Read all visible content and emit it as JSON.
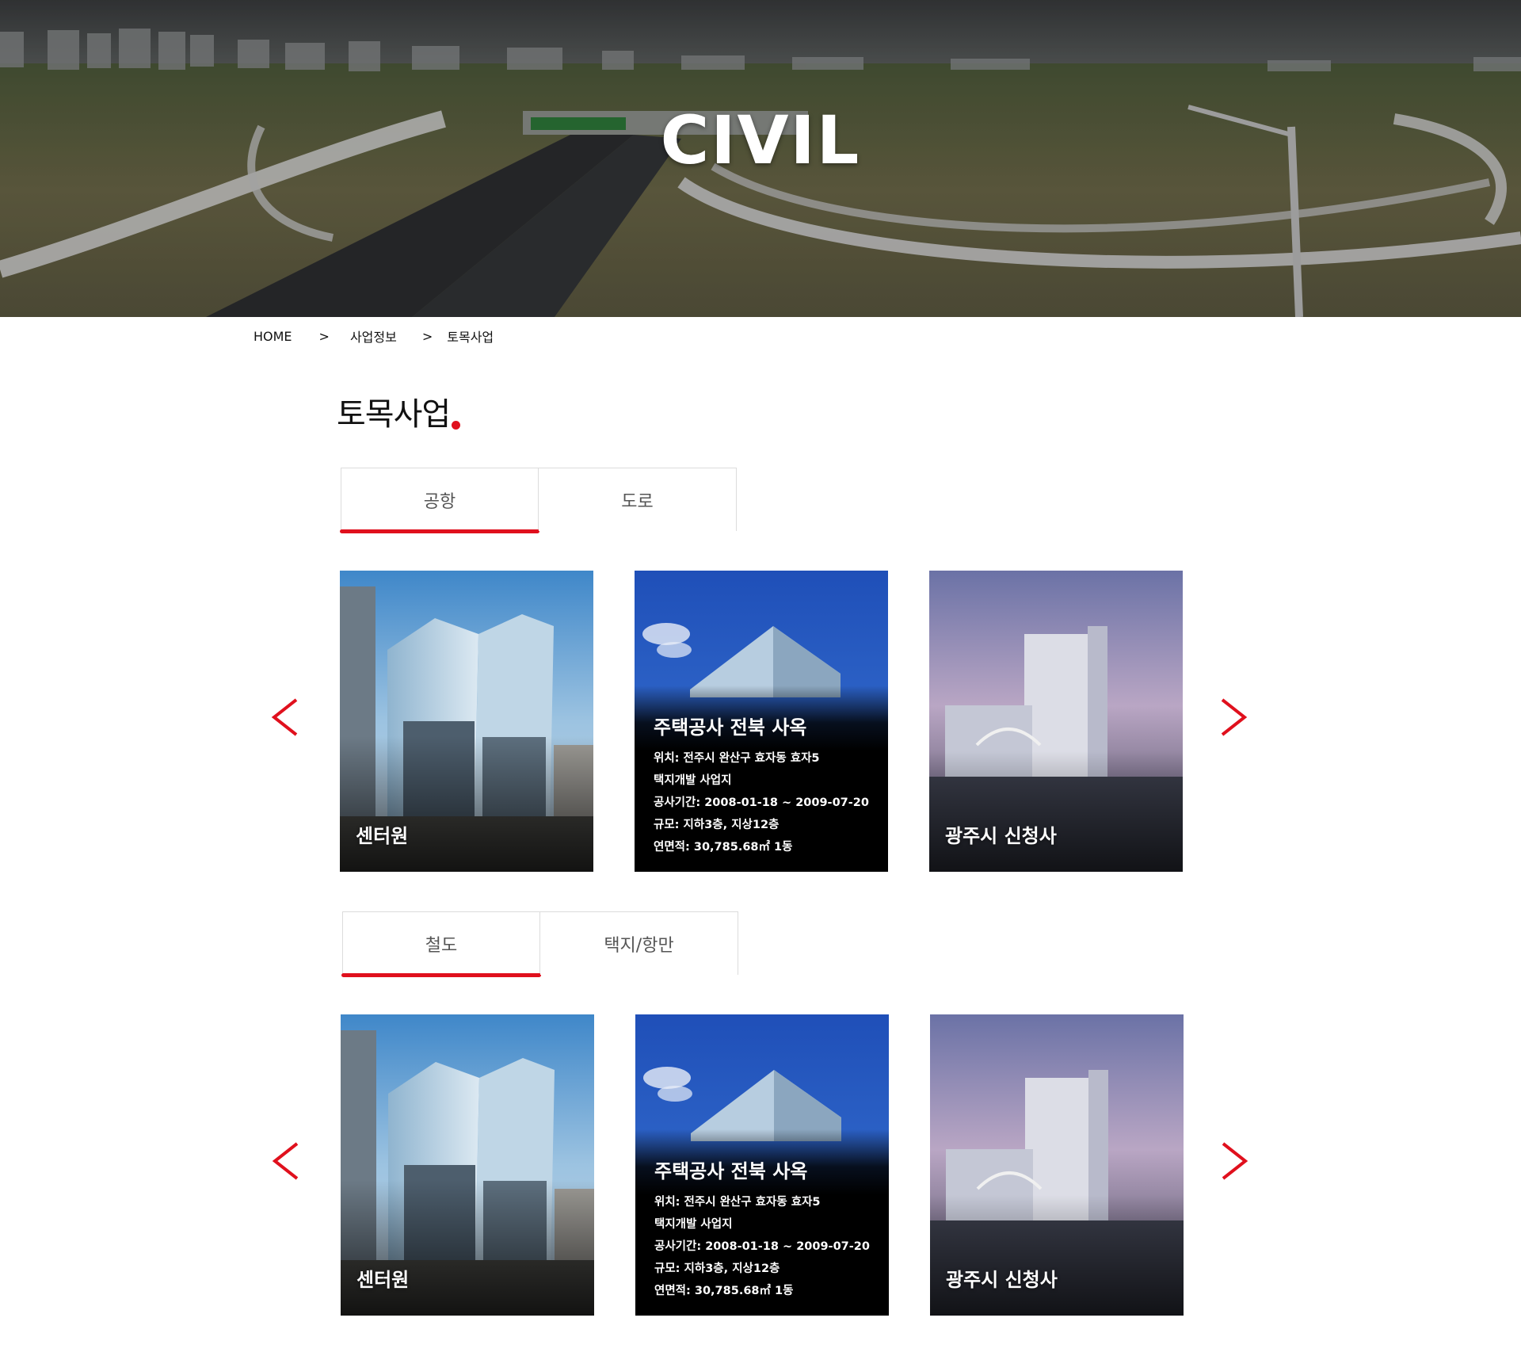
{
  "hero": {
    "title": "CIVIL"
  },
  "breadcrumb": {
    "home": "HOME",
    "sep1": ">",
    "level1": "사업정보",
    "sep2": ">",
    "level2": "토목사업"
  },
  "page": {
    "title": "토목사업"
  },
  "sections": [
    {
      "tabs": [
        {
          "label": "공항",
          "active": true
        },
        {
          "label": "도로",
          "active": false
        }
      ],
      "cards": [
        {
          "label": "센터원"
        },
        {
          "title": "주택공사 전북 사옥",
          "lines": [
            "위치: 전주시 완산구 효자동 효자5",
            "택지개발 사업지",
            "공사기간: 2008-01-18 ~ 2009-07-20",
            "규모: 지하3층, 지상12층",
            "연면적: 30,785.68㎡  1동"
          ]
        },
        {
          "label": "광주시 신청사"
        }
      ]
    },
    {
      "tabs": [
        {
          "label": "철도",
          "active": true
        },
        {
          "label": "택지/항만",
          "active": false
        }
      ],
      "cards": [
        {
          "label": "센터원"
        },
        {
          "title": "주택공사 전북 사옥",
          "lines": [
            "위치: 전주시 완산구 효자동 효자5",
            "택지개발 사업지",
            "공사기간: 2008-01-18 ~ 2009-07-20",
            "규모: 지하3층, 지상12층",
            "연면적: 30,785.68㎡  1동"
          ]
        },
        {
          "label": "광주시 신청사"
        }
      ]
    }
  ],
  "colors": {
    "accent": "#e0101d",
    "tab_border": "#dcdcdc",
    "overlay": "#000000"
  },
  "icons": {
    "prev": "chevron-left-icon",
    "next": "chevron-right-icon"
  }
}
